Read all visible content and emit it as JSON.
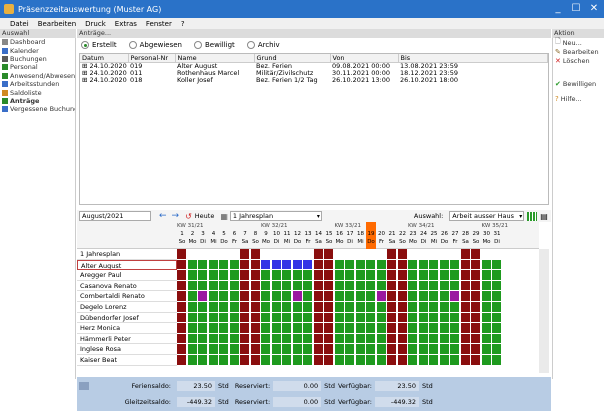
{
  "window": {
    "title": "Präsenzzeitauswertung (Muster AG)",
    "minimize": "_",
    "maximize": "☐",
    "close": "✕"
  },
  "menu": [
    "Datei",
    "Bearbeiten",
    "Druck",
    "Extras",
    "Fenster",
    "?"
  ],
  "left": {
    "header": "Auswahl",
    "items": [
      {
        "label": "Dashboard",
        "color": "#888888"
      },
      {
        "label": "Kalender",
        "color": "#3a6ec8"
      },
      {
        "label": "Buchungen",
        "color": "#5a5a5a"
      },
      {
        "label": "Personal",
        "color": "#2a8a2a"
      },
      {
        "label": "Anwesend/Abwesend",
        "color": "#2a8a2a"
      },
      {
        "label": "Arbeitsstunden",
        "color": "#3a6ec8"
      },
      {
        "label": "Saldoliste",
        "color": "#d08a20"
      },
      {
        "label": "Anträge",
        "color": "#2a8a2a",
        "active": true
      },
      {
        "label": "Vergessene Buchungen",
        "color": "#3a6ec8"
      }
    ]
  },
  "main": {
    "header": "Anträge...",
    "filters": [
      {
        "label": "Erstellt",
        "selected": true
      },
      {
        "label": "Abgewiesen",
        "selected": false
      },
      {
        "label": "Bewilligt",
        "selected": false
      },
      {
        "label": "Archiv",
        "selected": false
      }
    ],
    "columns": [
      "Datum",
      "Personal-Nr",
      "Name",
      "Grund",
      "Von",
      "Bis"
    ],
    "rows": [
      [
        "24.10.2020",
        "019",
        "Alter August",
        "Bez. Ferien",
        "09.08.2021 00:00",
        "13.08.2021 23:59"
      ],
      [
        "24.10.2020",
        "011",
        "Rothenhaus Marcel",
        "Militär/Zivilschutz",
        "30.11.2021 00:00",
        "18.12.2021 23:59"
      ],
      [
        "24.10.2020",
        "018",
        "Koller Josef",
        "Bez. Ferien 1/2 Tag",
        "26.10.2021 13:00",
        "26.10.2021 18:00"
      ]
    ]
  },
  "planbar": {
    "month": "August/2021",
    "today_label": "Heute",
    "plan_select": "1 Jahresplan",
    "auswahl_label": "Auswahl:",
    "auswahl_value": "Arbeit ausser Haus"
  },
  "plan": {
    "kw_labels": [
      "KW 31/21",
      "KW 32/21",
      "KW 33/21",
      "KW 34/21",
      "KW 35/21"
    ],
    "days": [
      "1",
      "2",
      "3",
      "4",
      "5",
      "6",
      "7",
      "8",
      "9",
      "10",
      "11",
      "12",
      "13",
      "14",
      "15",
      "16",
      "17",
      "18",
      "19",
      "20",
      "21",
      "22",
      "23",
      "24",
      "25",
      "26",
      "27",
      "28",
      "29",
      "30",
      "31"
    ],
    "weekdays": [
      "So",
      "Mo",
      "Di",
      "Mi",
      "Do",
      "Fr",
      "Sa",
      "So",
      "Mo",
      "Di",
      "Mi",
      "Do",
      "Fr",
      "Sa",
      "So",
      "Mo",
      "Di",
      "Mi",
      "Do",
      "Fr",
      "Sa",
      "So",
      "Mo",
      "Di",
      "Mi",
      "Do",
      "Fr",
      "Sa",
      "So",
      "Mo",
      "Di"
    ],
    "today_day": 19,
    "section": "1 Jahresplan",
    "people": [
      "Alter August",
      "Aregger Paul",
      "Casanova Renato",
      "Combertaldi Renato",
      "Degelo Lorenz",
      "Dübendorfer Josef",
      "Herz Monica",
      "Hämmerli Peter",
      "Inglese Rosa",
      "Kaiser Beat"
    ],
    "colors": {
      "work": "#1e9a1e",
      "weekend": "#8a0e0e",
      "holiday": "#3232e6",
      "special": "#9a18a0",
      "today": "#ff6a00"
    }
  },
  "right": {
    "header": "Aktion",
    "items": [
      {
        "label": "Neu...",
        "icon": "new-icon"
      },
      {
        "label": "Bearbeiten",
        "icon": "edit-icon"
      },
      {
        "label": "Löschen",
        "icon": "delete-icon"
      },
      {
        "label": "Bewilligen",
        "icon": "approve-icon"
      },
      {
        "label": "Hilfe...",
        "icon": "help-icon"
      }
    ]
  },
  "footer": {
    "ferien_label": "Feriensaldo:",
    "ferien_value": "23.50",
    "gleit_label": "Gleitzeitsaldo:",
    "gleit_value": "-449.32",
    "unit": "Std",
    "reserviert_label": "Reserviert:",
    "reserviert_value": "0.00",
    "verfuegbar_label": "Verfügbar:",
    "verfuegbar_ferien": "23.50",
    "verfuegbar_gleit": "-449.32"
  }
}
